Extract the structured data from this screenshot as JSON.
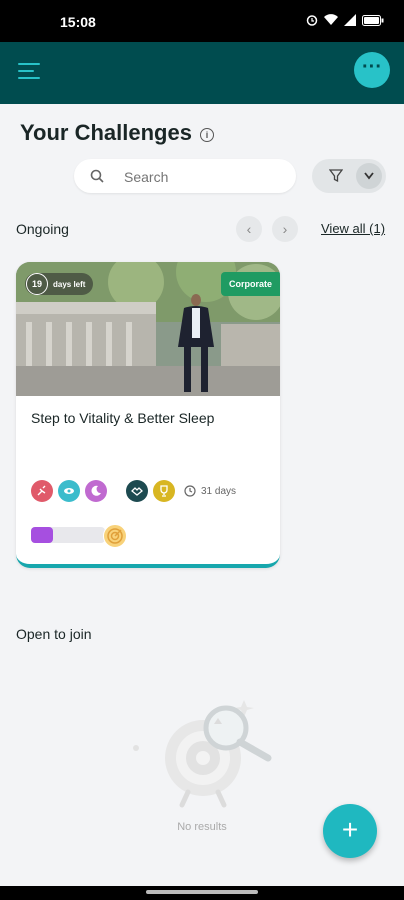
{
  "status_bar": {
    "time": "15:08"
  },
  "page": {
    "title": "Your Challenges"
  },
  "search": {
    "placeholder": "Search"
  },
  "ongoing": {
    "label": "Ongoing",
    "view_all": "View all (1)",
    "card": {
      "days_left_number": "19",
      "days_left_text": "days left",
      "badge": "Corporate",
      "title": "Step to Vitality & Better Sleep",
      "duration": "31 days",
      "progress_fraction": 0.3,
      "tag_icons": [
        "run-icon",
        "eye-icon",
        "moon-icon",
        "handshake-icon",
        "trophy-icon"
      ],
      "tag_colors": [
        "#e05a6a",
        "#3bbccc",
        "#c06ad0",
        "#1d4a50",
        "#d8b622"
      ]
    }
  },
  "open_to_join": {
    "label": "Open to join",
    "empty_text": "No results"
  },
  "colors": {
    "header": "#004c4f",
    "accent": "#28c2c8",
    "fab": "#1fb8c0"
  }
}
